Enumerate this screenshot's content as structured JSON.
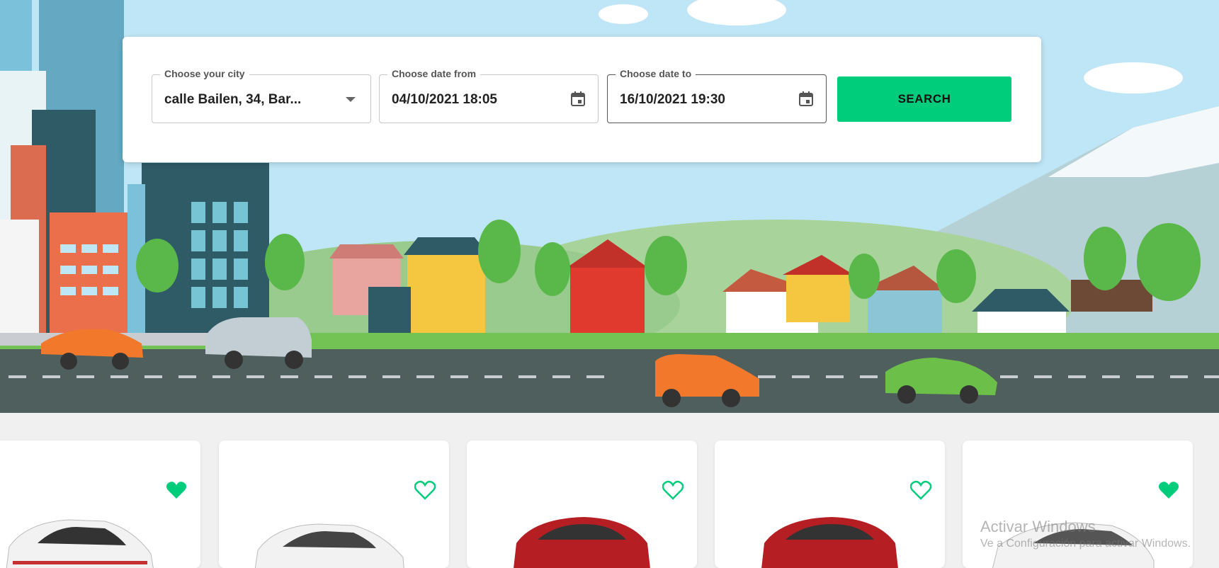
{
  "search": {
    "city_label": "Choose your city",
    "city_value": "calle Bailen, 34, Bar...",
    "date_from_label": "Choose date from",
    "date_from_value": "04/10/2021 18:05",
    "date_to_label": "Choose date to",
    "date_to_value": "16/10/2021 19:30",
    "button_label": "SEARCH"
  },
  "cards": [
    {
      "favorite": true,
      "car_color": "#f2f2f2"
    },
    {
      "favorite": false,
      "car_color": "#f2f2f2"
    },
    {
      "favorite": false,
      "car_color": "#b51f24"
    },
    {
      "favorite": false,
      "car_color": "#b51f24"
    },
    {
      "favorite": true,
      "car_color": "#f2f2f2"
    }
  ],
  "watermark": {
    "line1": "Activar Windows",
    "line2": "Ve a Configuración para activar Windows."
  },
  "colors": {
    "accent": "#00cd7c",
    "sky": "#bfe6f6",
    "road": "#4f5f5d"
  }
}
